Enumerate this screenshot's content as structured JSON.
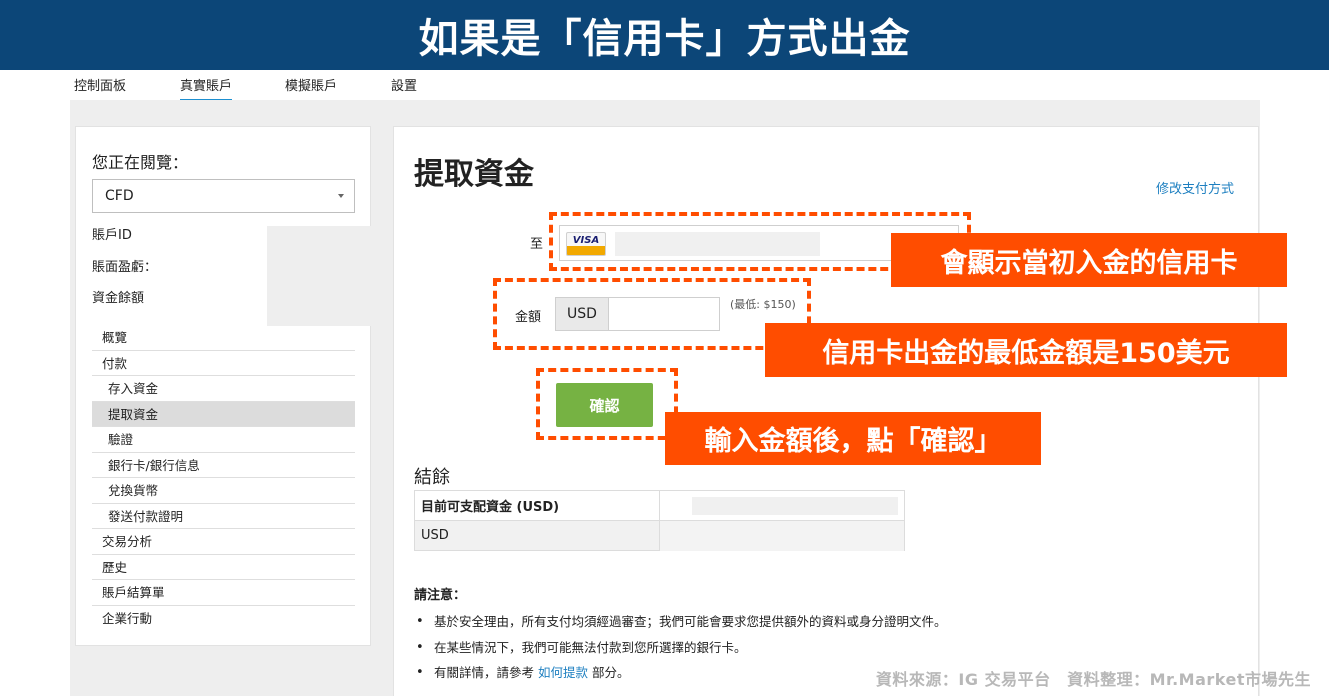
{
  "banner": {
    "title": "如果是「信用卡」方式出金"
  },
  "topnav": {
    "items": [
      "控制面板",
      "真實賬戶",
      "模擬賬戶",
      "設置"
    ],
    "active": "真實賬戶"
  },
  "sidebar": {
    "viewing_label": "您正在閱覽：",
    "account_type": "CFD",
    "info": {
      "account_id": "賬戶ID",
      "pnl": "賬面盈虧：",
      "balance": "資金餘額"
    },
    "menu": [
      {
        "label": "概覽",
        "level": 0
      },
      {
        "label": "付款",
        "level": 0
      },
      {
        "label": "存入資金",
        "level": 1
      },
      {
        "label": "提取資金",
        "level": 1,
        "selected": true
      },
      {
        "label": "驗證",
        "level": 1
      },
      {
        "label": "銀行卡/銀行信息",
        "level": 1
      },
      {
        "label": "兌換貨幣",
        "level": 1
      },
      {
        "label": "發送付款證明",
        "level": 1
      },
      {
        "label": "交易分析",
        "level": 0
      },
      {
        "label": "歷史",
        "level": 0
      },
      {
        "label": "賬戶結算單",
        "level": 0
      },
      {
        "label": "企業行動",
        "level": 0
      }
    ]
  },
  "main": {
    "title": "提取資金",
    "change_payment": "修改支付方式",
    "to_label": "至",
    "card_brand": "VISA",
    "amount_label": "金額",
    "currency": "USD",
    "amount_value": "",
    "min_note": "(最低: $150)",
    "confirm": "確認",
    "balance_title": "結餘",
    "balance_table": {
      "header": "目前可支配資金 (USD)",
      "row": "USD"
    },
    "notes_title": "請注意：",
    "notes": [
      "基於安全理由，所有支付均須經過審查；我們可能會要求您提供額外的資料或身分證明文件。",
      "在某些情況下，我們可能無法付款到您所選擇的銀行卡。"
    ],
    "note3": {
      "prefix": "有關詳情，請參考 ",
      "link": "如何提款",
      "suffix": " 部分。"
    }
  },
  "annotations": {
    "card": "會顯示當初入金的信用卡",
    "minimum": "信用卡出金的最低金額是150美元",
    "confirm": "輸入金額後，點「確認」"
  },
  "source": "資料來源：IG 交易平台　資料整理：Mr.Market市場先生",
  "colors": {
    "banner": "#0c4678",
    "accent": "#ff4d00",
    "confirm": "#76b243",
    "link": "#1d7fc0"
  }
}
